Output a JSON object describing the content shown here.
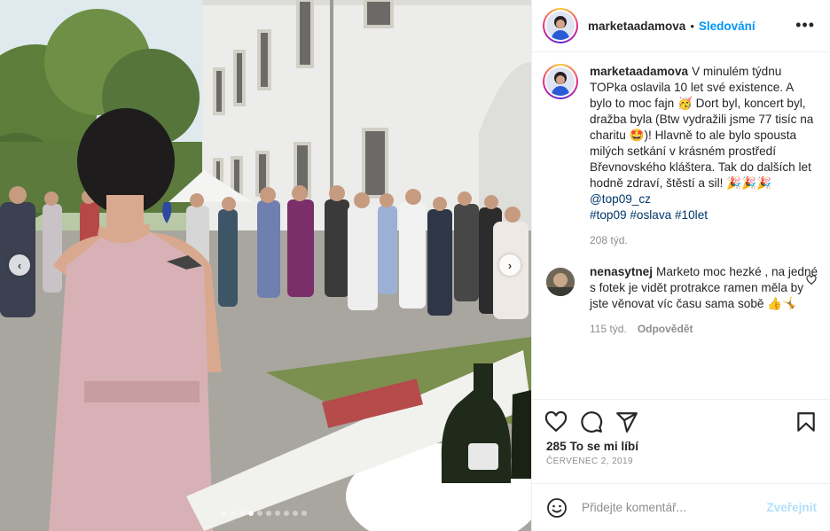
{
  "post": {
    "author": "marketaadamova",
    "follow_label": "Sledování",
    "more_label": "•••",
    "separator": "•"
  },
  "photo": {
    "prev_label": "‹",
    "next_label": "›",
    "slide_count": 10,
    "active_slide": 3
  },
  "caption": {
    "user": "marketaadamova",
    "text": "V minulém týdnu TOPka oslavila 10 let své existence. A bylo to moc fajn 🥳 Dort byl, koncert byl, dražba byla (Btw vydražili jsme 77 tisíc na charitu 🤩)! Hlavně to ale bylo spousta milých setkání v krásném prostředí Břevnovského kláštera. Tak do dalších let hodně zdraví, štěstí a sil! 🎉🎉🎉",
    "mention": "@top09_cz",
    "hashtags": [
      "#top09",
      "#oslava",
      "#10let"
    ],
    "age": "208 týd."
  },
  "comments": [
    {
      "user": "nenasytnej",
      "text": "Marketo moc hezké , na jedné s fotek je vidět protrakce ramen měla by jste věnovat víc času sama sobě 👍🤸",
      "age": "115 týd.",
      "reply_label": "Odpovědět"
    }
  ],
  "actions": {
    "like_icon": "heart-icon",
    "comment_icon": "comment-icon",
    "share_icon": "share-icon",
    "save_icon": "bookmark-icon"
  },
  "likes_text": "285 To se mi líbí",
  "date_text": "ČERVENEC 2, 2019",
  "add_comment": {
    "placeholder": "Přidejte komentář...",
    "post_label": "Zveřejnit"
  },
  "colors": {
    "accent": "#0095f6",
    "link": "#00376b",
    "muted": "#8e8e8e",
    "post_disabled": "#b2dffc"
  }
}
